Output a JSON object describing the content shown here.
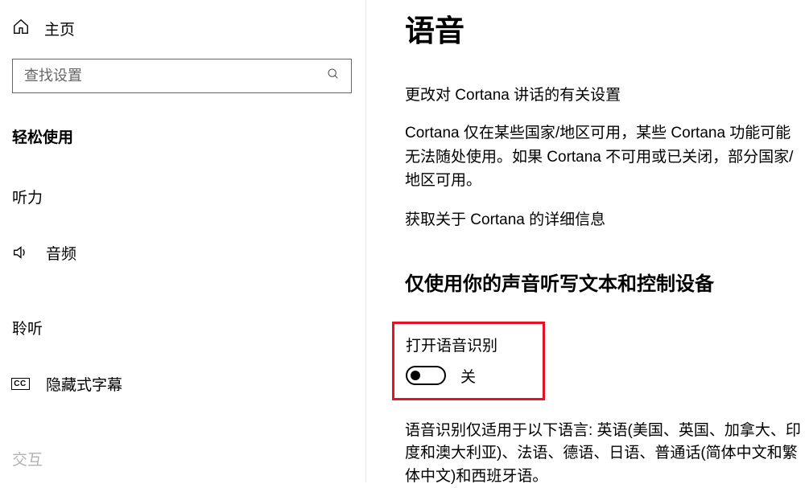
{
  "sidebar": {
    "home_label": "主页",
    "search_placeholder": "查找设置",
    "category_title": "轻松使用",
    "sections": [
      {
        "heading": "听力",
        "items": [
          {
            "label": "音频",
            "icon": "volume"
          }
        ]
      },
      {
        "heading": "聆听",
        "items": [
          {
            "label": "隐藏式字幕",
            "icon": "cc"
          }
        ]
      },
      {
        "heading": "交互",
        "items": []
      }
    ]
  },
  "main": {
    "page_title": "语音",
    "cortana_intro": "更改对 Cortana 讲话的有关设置",
    "cortana_body": "Cortana 仅在某些国家/地区可用，某些 Cortana 功能可能无法随处使用。如果 Cortana 不可用或已关闭，部分国家/地区可用。",
    "cortana_link": "获取关于 Cortana 的详细信息",
    "voice_section_title": "仅使用你的声音听写文本和控制设备",
    "toggle": {
      "label": "打开语音识别",
      "state": "关",
      "on": false
    },
    "voice_note": "语音识别仅适用于以下语言: 英语(美国、英国、加拿大、印度和澳大利亚)、法语、德语、日语、普通话(简体中文和繁体中文)和西班牙语。"
  }
}
